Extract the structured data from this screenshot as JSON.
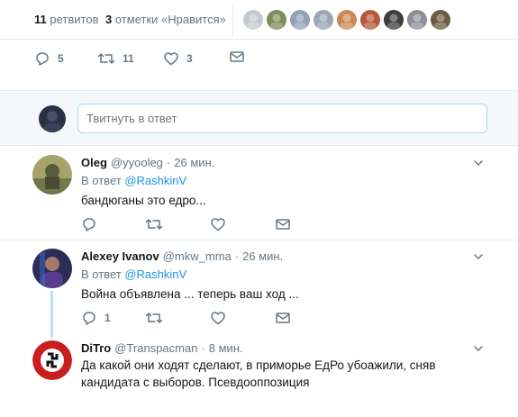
{
  "stats": {
    "retweets_count": "11",
    "retweets_label": "ретвитов",
    "likes_count": "3",
    "likes_label": "отметки «Нравится»",
    "likers": [
      {
        "name": "liker-avatar-1",
        "color": "#c3cad1"
      },
      {
        "name": "liker-avatar-2",
        "color": "#7c8c5a"
      },
      {
        "name": "liker-avatar-3",
        "color": "#8fa0b8"
      },
      {
        "name": "liker-avatar-4",
        "color": "#9aa5b6"
      },
      {
        "name": "liker-avatar-5",
        "color": "#c88a52"
      },
      {
        "name": "liker-avatar-6",
        "color": "#b3563a"
      },
      {
        "name": "liker-avatar-7",
        "color": "#3e3e3e"
      },
      {
        "name": "liker-avatar-8",
        "color": "#8c8f96"
      },
      {
        "name": "liker-avatar-9",
        "color": "#6b5a3e"
      }
    ]
  },
  "main_actions": {
    "reply_count": "5",
    "retweet_count": "11",
    "like_count": "3"
  },
  "reply_box": {
    "placeholder": "Твитнуть в ответ"
  },
  "tweets": [
    {
      "name": "Oleg",
      "handle": "@yyooleg",
      "dot": "·",
      "time": "26 мин.",
      "replyto_prefix": "В ответ",
      "replyto_mention": "@RashkinV",
      "text": "бандюганы это едро...",
      "reply_count": "",
      "avatar_color": "#6e7a4a"
    },
    {
      "name": "Alexey Ivanov",
      "handle": "@mkw_mma",
      "dot": "·",
      "time": "26 мин.",
      "replyto_prefix": "В ответ",
      "replyto_mention": "@RashkinV",
      "text": "Война объявлена ... теперь ваш ход ...",
      "reply_count": "1",
      "avatar_color": "#4a4a8a"
    },
    {
      "name": "DiTro",
      "handle": "@Transpacman",
      "dot": "·",
      "time": "8 мин.",
      "text": "Да какой они ходят сделают, в приморье ЕдРо убоажили, сняв кандидата с выборов. Псевдооппозиция",
      "avatar_color": "#c81e1e"
    }
  ],
  "colors": {
    "accent": "#1b95e0",
    "muted": "#657786",
    "border": "#e6ecf0",
    "thread_line": "#b7e0f5"
  }
}
